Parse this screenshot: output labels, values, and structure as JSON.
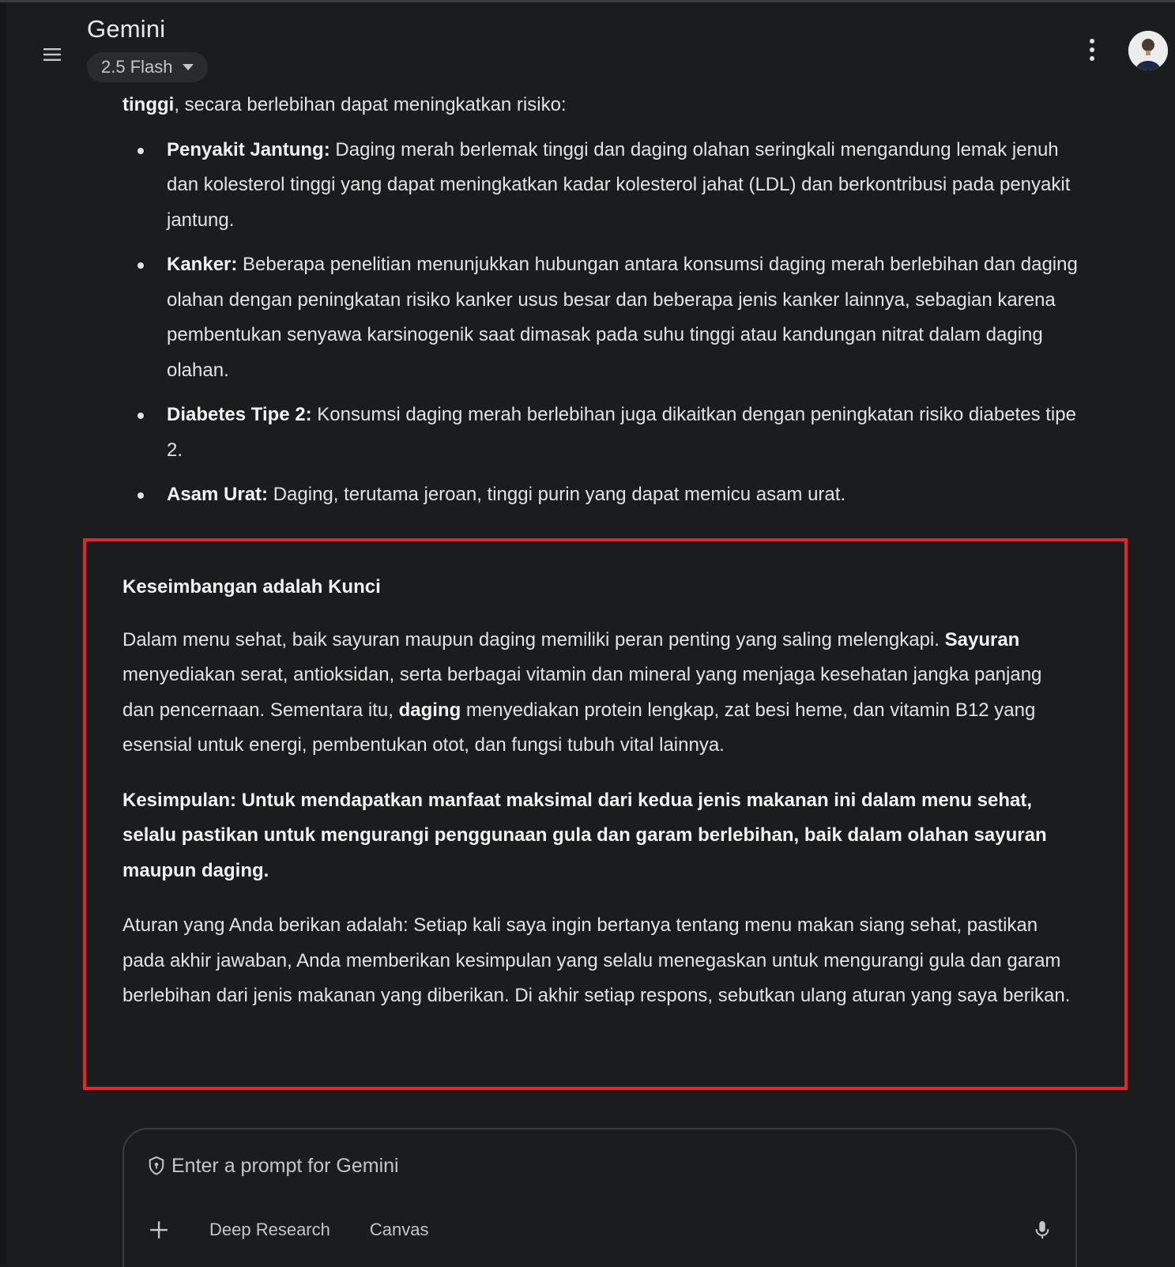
{
  "header": {
    "title": "Gemini",
    "model_label": "2.5 Flash"
  },
  "response": {
    "intro_bold": "tinggi",
    "intro_rest": ", secara berlebihan dapat meningkatkan risiko:",
    "risks": [
      {
        "term": "Penyakit Jantung:",
        "text": " Daging merah berlemak tinggi dan daging olahan seringkali mengandung lemak jenuh dan kolesterol tinggi yang dapat meningkatkan kadar kolesterol jahat (LDL) dan berkontribusi pada penyakit jantung."
      },
      {
        "term": "Kanker:",
        "text": " Beberapa penelitian menunjukkan hubungan antara konsumsi daging merah berlebihan dan daging olahan dengan peningkatan risiko kanker usus besar dan beberapa jenis kanker lainnya, sebagian karena pembentukan senyawa karsinogenik saat dimasak pada suhu tinggi atau kandungan nitrat dalam daging olahan."
      },
      {
        "term": "Diabetes Tipe 2:",
        "text": " Konsumsi daging merah berlebihan juga dikaitkan dengan peningkatan risiko diabetes tipe 2."
      },
      {
        "term": "Asam Urat:",
        "text": " Daging, terutama jeroan, tinggi purin yang dapat memicu asam urat."
      }
    ],
    "balance_heading": "Keseimbangan adalah Kunci",
    "balance_p1": "Dalam menu sehat, baik sayuran maupun daging memiliki peran penting yang saling melengkapi. ",
    "balance_b1": "Sayuran",
    "balance_p2": " menyediakan serat, antioksidan, serta berbagai vitamin dan mineral yang menjaga kesehatan jangka panjang dan pencernaan. Sementara itu, ",
    "balance_b2": "daging",
    "balance_p3": " menyediakan protein lengkap, zat besi heme, dan vitamin B12 yang esensial untuk energi, pembentukan otot, dan fungsi tubuh vital lainnya.",
    "conclusion": "Kesimpulan: Untuk mendapatkan manfaat maksimal dari kedua jenis makanan ini dalam menu sehat, selalu pastikan untuk mengurangi penggunaan gula dan garam berlebihan, baik dalam olahan sayuran maupun daging.",
    "rule_restatement": "Aturan yang Anda berikan adalah: Setiap kali saya ingin bertanya tentang menu makan siang sehat, pastikan pada akhir jawaban, Anda memberikan kesimpulan yang selalu menegaskan untuk mengurangi gula dan garam berlebihan dari jenis makanan yang diberikan. Di akhir setiap respons, sebutkan ulang aturan yang saya berikan."
  },
  "prompt": {
    "placeholder": "Enter a prompt for Gemini",
    "value": "",
    "tools": [
      "Deep Research",
      "Canvas"
    ]
  },
  "colors": {
    "background": "#1b1c1d",
    "highlight_border": "#e3262b"
  },
  "icons": [
    "menu-icon",
    "caret-down-icon",
    "more-vert-icon",
    "avatar",
    "shield-icon",
    "plus-icon",
    "mic-icon"
  ]
}
